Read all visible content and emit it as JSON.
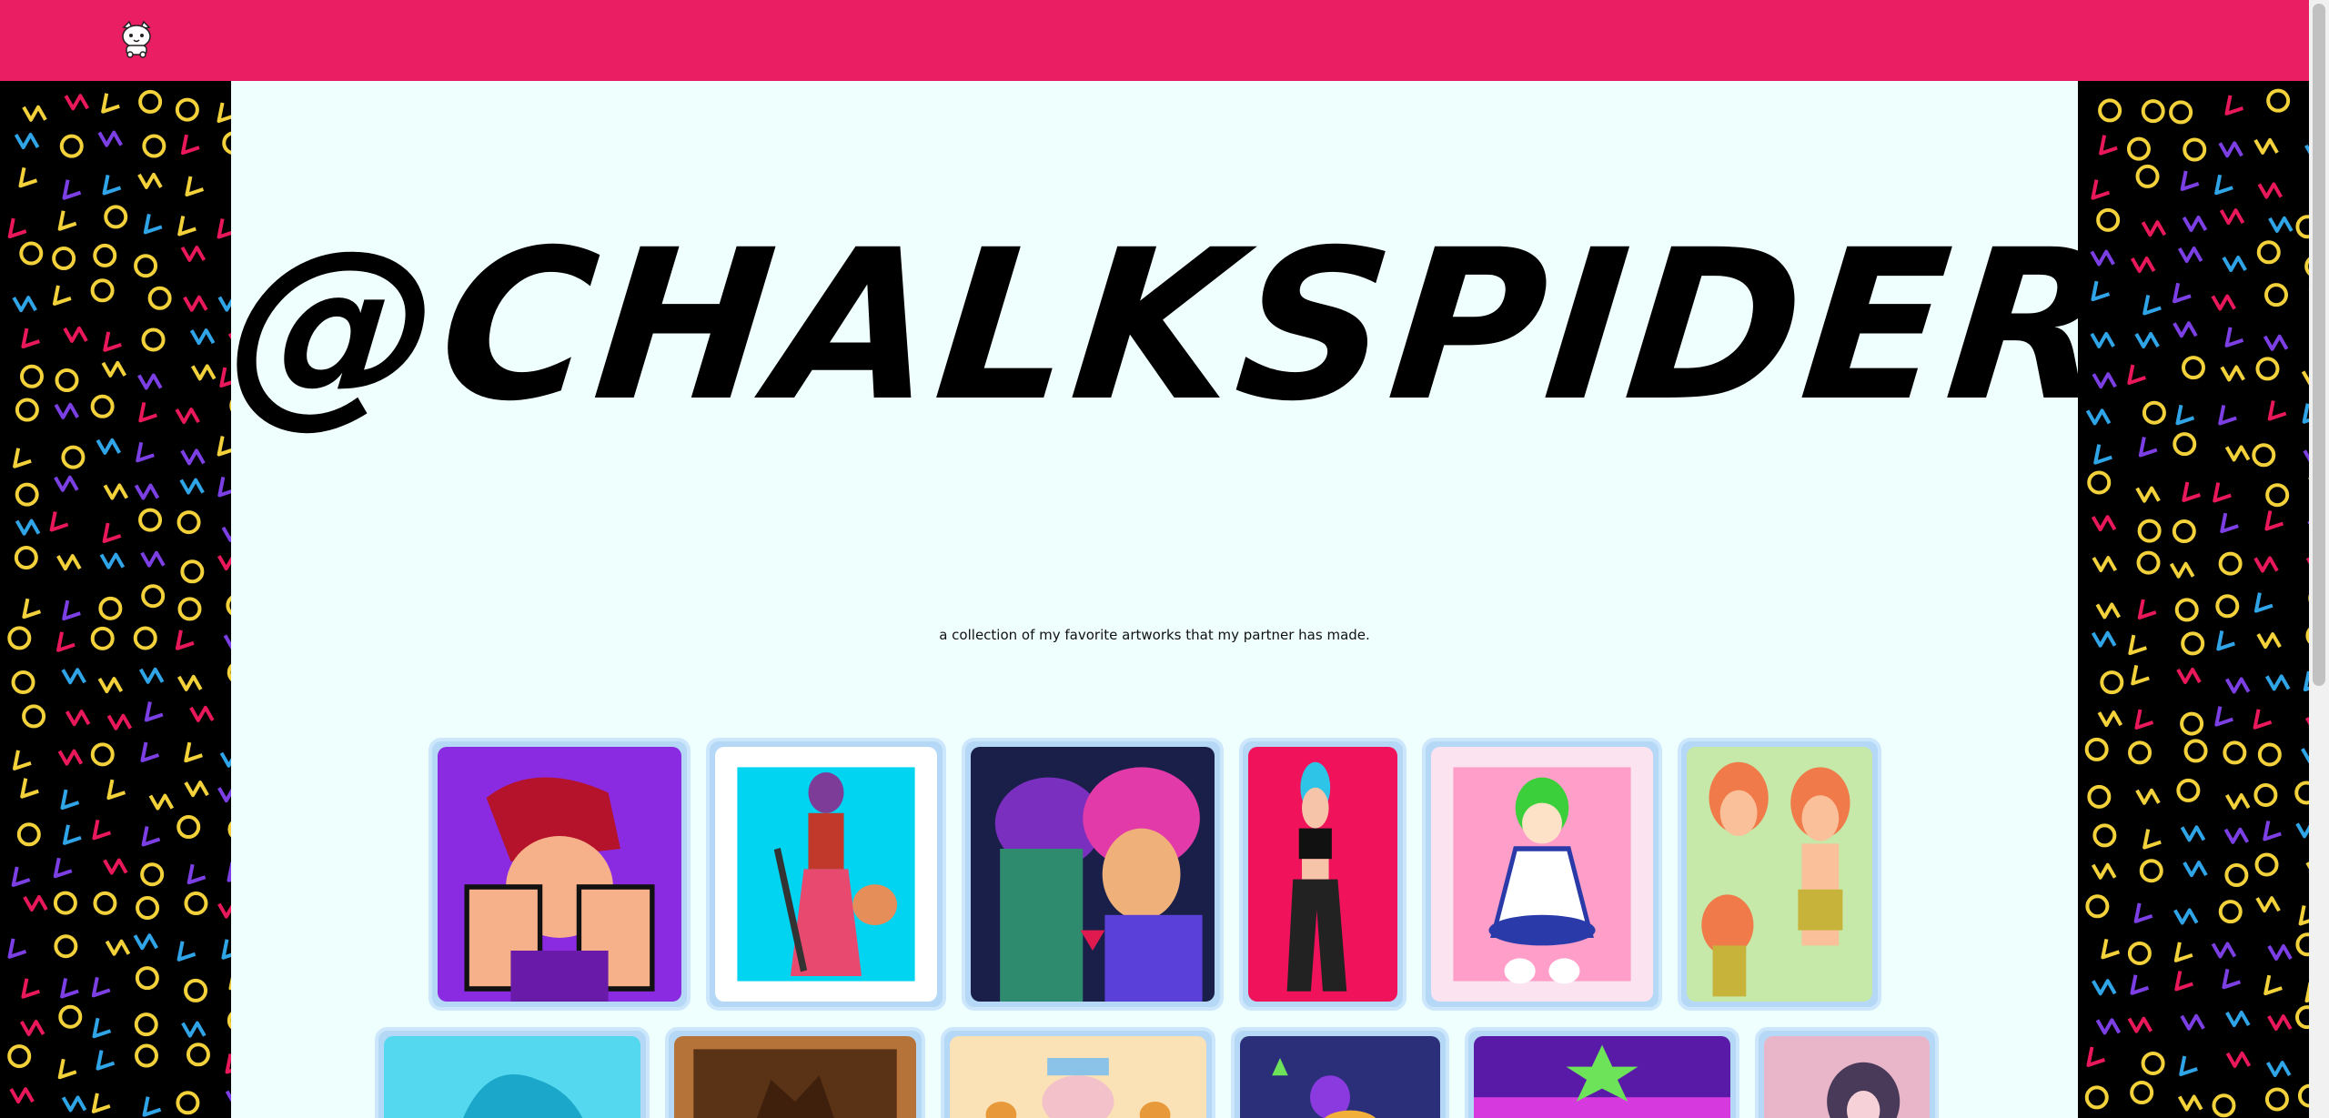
{
  "header": {
    "logo_icon": "cat-mascot-icon",
    "brand_color": "#e91e63"
  },
  "page": {
    "title": "@CHALKSPIDER",
    "description": "a collection of my favorite artworks that my partner has made."
  },
  "gallery": {
    "card_color": "#b5d8f7"
  }
}
